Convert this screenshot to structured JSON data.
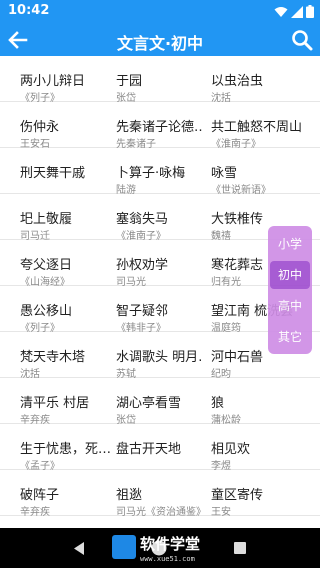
{
  "status_bar": {
    "time": "10:42"
  },
  "app_bar": {
    "title": "文言文·初中"
  },
  "rows": [
    [
      {
        "title": "两小儿辩日",
        "author": "《列子》"
      },
      {
        "title": "于园",
        "author": "张岱"
      },
      {
        "title": "以虫治虫",
        "author": "沈括"
      }
    ],
    [
      {
        "title": "伤仲永",
        "author": "王安石"
      },
      {
        "title": "先秦诸子论德…",
        "author": "先秦诸子"
      },
      {
        "title": "共工触怒不周山",
        "author": "《淮南子》"
      }
    ],
    [
      {
        "title": "刑天舞干戚",
        "author": ""
      },
      {
        "title": "卜算子·咏梅",
        "author": "陆游"
      },
      {
        "title": "咏雪",
        "author": "《世说新语》"
      }
    ],
    [
      {
        "title": "圯上敬履",
        "author": "司马迁"
      },
      {
        "title": "塞翁失马",
        "author": "《淮南子》"
      },
      {
        "title": "大铁椎传",
        "author": "魏禧"
      }
    ],
    [
      {
        "title": "夸父逐日",
        "author": "《山海经》"
      },
      {
        "title": "孙权劝学",
        "author": "司马光"
      },
      {
        "title": "寒花葬志",
        "author": "归有光"
      }
    ],
    [
      {
        "title": "愚公移山",
        "author": "《列子》"
      },
      {
        "title": "智子疑邻",
        "author": "《韩非子》"
      },
      {
        "title": "望江南 梳洗罢",
        "author": "温庭筠"
      }
    ],
    [
      {
        "title": "梵天寺木塔",
        "author": "沈括"
      },
      {
        "title": "水调歌头 明月…",
        "author": "苏轼"
      },
      {
        "title": "河中石兽",
        "author": "纪昀"
      }
    ],
    [
      {
        "title": "清平乐 村居",
        "author": "辛弃疾"
      },
      {
        "title": "湖心亭看雪",
        "author": "张岱"
      },
      {
        "title": "狼",
        "author": "蒲松龄"
      }
    ],
    [
      {
        "title": "生于忧患，死…",
        "author": "《孟子》"
      },
      {
        "title": "盘古开天地",
        "author": ""
      },
      {
        "title": "相见欢",
        "author": "李煜"
      }
    ],
    [
      {
        "title": "破阵子",
        "author": "辛弃疾"
      },
      {
        "title": "祖逖",
        "author": "司马光《资治通鉴》"
      },
      {
        "title": "童区寄传",
        "author": "王安"
      }
    ]
  ],
  "level_menu": {
    "items": [
      "小学",
      "初中",
      "高中",
      "其它"
    ],
    "selected": "初中"
  },
  "watermark": {
    "text": "软件学堂",
    "url": "www.xue51.com"
  },
  "colors": {
    "primary": "#2196f3",
    "menu_bg": "#cf8ee6",
    "menu_active": "#a04fd0",
    "nav_bar": "#000000"
  }
}
